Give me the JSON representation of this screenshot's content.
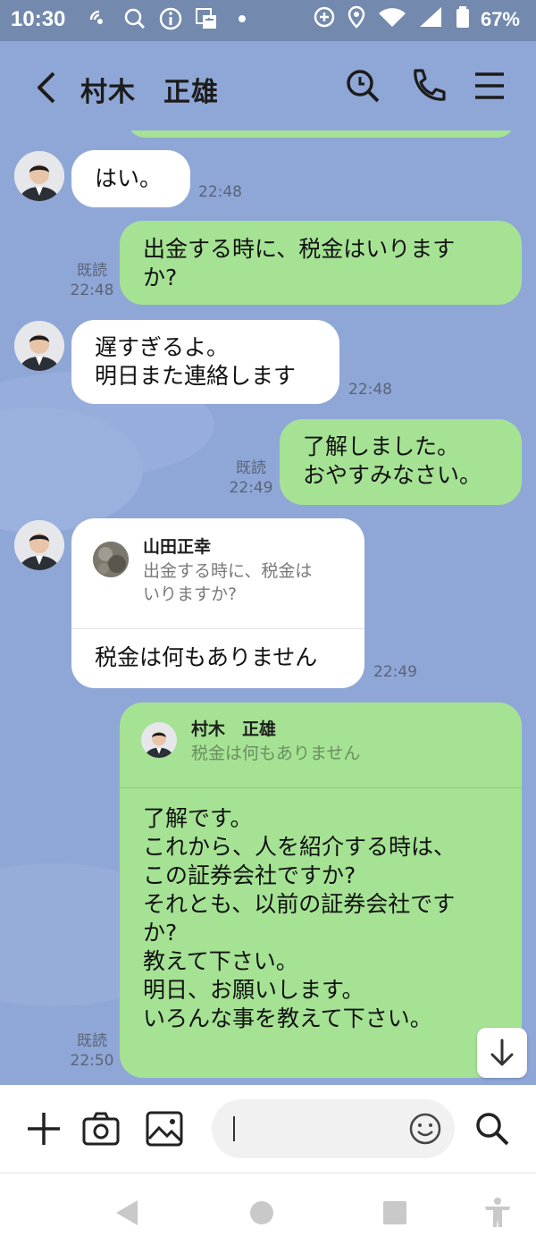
{
  "status_bar": {
    "time": "10:30",
    "battery": "67%"
  },
  "header": {
    "title": "村木　正雄"
  },
  "messages": {
    "m1": {
      "text": "はい。",
      "time": "22:48"
    },
    "m2": {
      "text": "出金する時に、税金はいります\nか?",
      "read": "既読",
      "time": "22:48"
    },
    "m3": {
      "text": "遅すぎるよ。\n明日また連絡します",
      "time": "22:48"
    },
    "m4": {
      "text": "了解しました。\nおやすみなさい。",
      "read": "既読",
      "time": "22:49"
    },
    "m5": {
      "reply_name": "山田正幸",
      "reply_text": "出金する時に、税金は\nいりますか?",
      "text": "税金は何もありません",
      "time": "22:49"
    },
    "m6": {
      "reply_name": "村木　正雄",
      "reply_text": "税金は何もありません",
      "text": "了解です。\nこれから、人を紹介する時は、\nこの証券会社ですか?\nそれとも、以前の証券会社です\nか?\n教えて下さい。\n明日、お願いします。\nいろんな事を教えて下さい。",
      "read": "既読",
      "time": "22:50"
    }
  },
  "colors": {
    "chat_background": "#8fa7d6",
    "status_bar": "#7389ad",
    "bubble_incoming": "#ffffff",
    "bubble_outgoing": "#a5e294"
  },
  "icons": {
    "header": [
      "back-icon",
      "search-icon",
      "phone-icon",
      "menu-icon"
    ],
    "input": [
      "plus-icon",
      "camera-icon",
      "image-icon",
      "emoji-icon",
      "search-icon"
    ],
    "nav": [
      "back-triangle-icon",
      "home-circle-icon",
      "recents-square-icon",
      "accessibility-icon"
    ]
  }
}
